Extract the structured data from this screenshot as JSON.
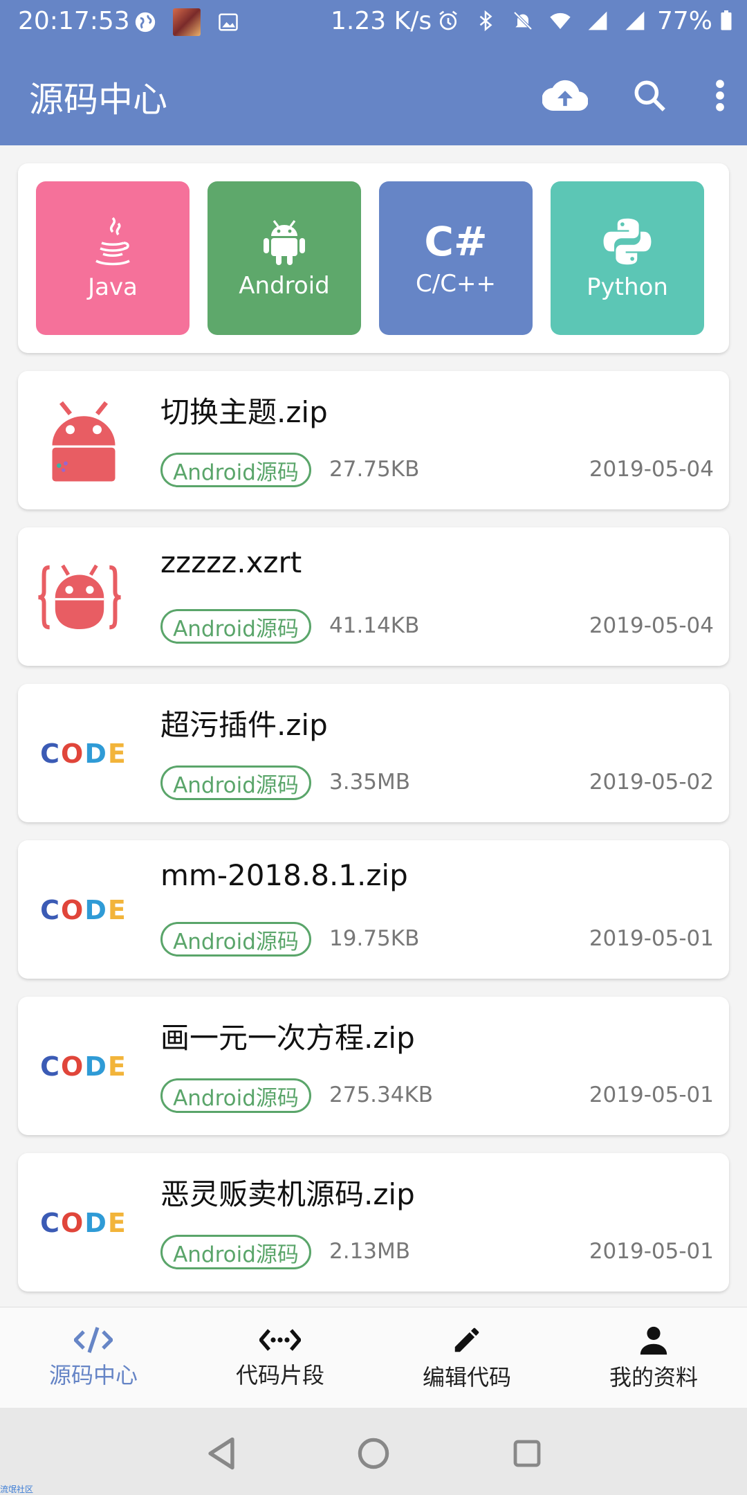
{
  "status_bar": {
    "time": "20:17:53",
    "speed": "1.23 K/s",
    "battery": "77%"
  },
  "app_bar": {
    "title": "源码中心",
    "icons": [
      "cloud-upload-icon",
      "search-icon",
      "more-vert-icon"
    ]
  },
  "categories": [
    {
      "label": "Java",
      "color": "#f5719a",
      "icon": "java-icon"
    },
    {
      "label": "Android",
      "color": "#5ea86b",
      "icon": "android-icon"
    },
    {
      "label": "C/C++",
      "color": "#6685c6",
      "icon": "csharp-icon",
      "glyph": "C#"
    },
    {
      "label": "Python",
      "color": "#5cc6b5",
      "icon": "python-icon"
    }
  ],
  "files": [
    {
      "name": "切换主题.zip",
      "tag": "Android源码",
      "size": "27.75KB",
      "date": "2019-05-04",
      "thumb": "android-robot"
    },
    {
      "name": "zzzzz.xzrt",
      "tag": "Android源码",
      "size": "41.14KB",
      "date": "2019-05-04",
      "thumb": "android-braces"
    },
    {
      "name": "超污插件.zip",
      "tag": "Android源码",
      "size": "3.35MB",
      "date": "2019-05-02",
      "thumb": "code-logo"
    },
    {
      "name": "mm-2018.8.1.zip",
      "tag": "Android源码",
      "size": "19.75KB",
      "date": "2019-05-01",
      "thumb": "code-logo"
    },
    {
      "name": "画一元一次方程.zip",
      "tag": "Android源码",
      "size": "275.34KB",
      "date": "2019-05-01",
      "thumb": "code-logo"
    },
    {
      "name": "恶灵贩卖机源码.zip",
      "tag": "Android源码",
      "size": "2.13MB",
      "date": "2019-05-01",
      "thumb": "code-logo"
    }
  ],
  "code_logo": {
    "letters": [
      "C",
      "O",
      "D",
      "E"
    ],
    "colors": [
      "#3b5bb5",
      "#e0453a",
      "#2f9bd6",
      "#f2b43a"
    ]
  },
  "bottom_nav": [
    {
      "label": "源码中心",
      "icon": "code-icon",
      "active": true
    },
    {
      "label": "代码片段",
      "icon": "code-dots-icon",
      "active": false
    },
    {
      "label": "编辑代码",
      "icon": "pencil-icon",
      "active": false
    },
    {
      "label": "我的资料",
      "icon": "person-icon",
      "active": false
    }
  ],
  "watermark": "流氓社区",
  "colors": {
    "primary": "#6685c6",
    "tag_green": "#5aa56a"
  }
}
